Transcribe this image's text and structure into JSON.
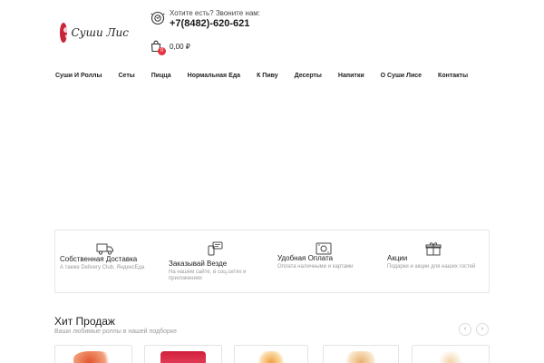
{
  "header": {
    "logo_text": "Суши Лис",
    "phone_label": "Хотите есть? Звоните нам:",
    "phone_number": "+7(8482)-620-621",
    "cart_count": "0",
    "cart_total": "0,00 ₽"
  },
  "nav": {
    "items": [
      {
        "label": "Суши И Роллы"
      },
      {
        "label": "Сеты"
      },
      {
        "label": "Пицца"
      },
      {
        "label": "Нормальная Еда"
      },
      {
        "label": "К Пиву"
      },
      {
        "label": "Десерты"
      },
      {
        "label": "Напитки"
      },
      {
        "label": "О Суши Лисе"
      },
      {
        "label": "Контакты"
      }
    ]
  },
  "features": [
    {
      "icon": "delivery-truck-icon",
      "title": "Собственная Доставка",
      "sub1": "А также Delivery Club, ЯндексЕда",
      "sub2": ""
    },
    {
      "icon": "order-anywhere-icon",
      "title": "Заказывай Везде",
      "sub1": "На нашем сайте, в соц.сетях и",
      "sub2": "приложениях"
    },
    {
      "icon": "payment-register-icon",
      "title": "Удобная Оплата",
      "sub1": "Оплата наличными и картами",
      "sub2": ""
    },
    {
      "icon": "gift-box-icon",
      "title": "Акции",
      "sub1": "Подарки и акции для наших гостей",
      "sub2": ""
    }
  ],
  "hits": {
    "title": "Хит Продаж",
    "subtitle": "Ваши любимые роллы в нашей подборке",
    "prev_icon": "chevron-left-icon",
    "next_icon": "chevron-right-icon",
    "prev_glyph": "‹",
    "next_glyph": "›"
  },
  "colors": {
    "accent_red": "#e3343f",
    "logo_red": "#c8243a",
    "border": "#e6e6e6",
    "muted_text": "#999999"
  }
}
